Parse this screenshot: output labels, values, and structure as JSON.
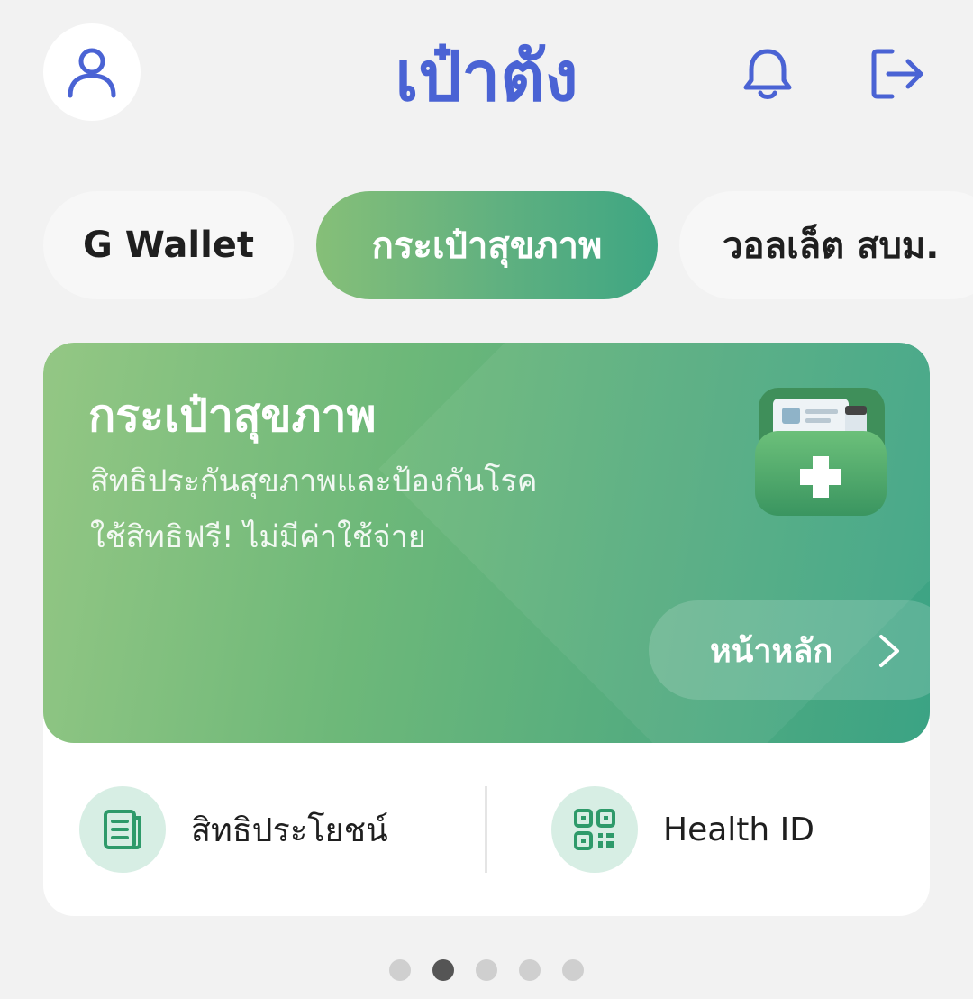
{
  "header": {
    "title": "เป๋าตัง",
    "profile_icon": "user-icon",
    "notification_icon": "bell-icon",
    "logout_icon": "logout-icon"
  },
  "tabs": [
    {
      "label": "G Wallet",
      "active": false
    },
    {
      "label": "กระเป๋าสุขภาพ",
      "active": true
    },
    {
      "label": "วอลเล็ต สบม.",
      "active": false
    }
  ],
  "card": {
    "title": "กระเป๋าสุขภาพ",
    "line1": "สิทธิประกันสุขภาพและป้องกันโรค",
    "line2": "ใช้สิทธิฟรี! ไม่มีค่าใช้จ่าย",
    "icon": "health-wallet-icon",
    "home_button": "หน้าหลัก",
    "actions": [
      {
        "label": "สิทธิประโยชน์",
        "icon": "document-icon"
      },
      {
        "label": "Health ID",
        "icon": "qr-code-icon"
      }
    ]
  },
  "pager": {
    "count": 5,
    "active_index": 1
  },
  "colors": {
    "brand": "#4a63d4",
    "green_start": "#94c784",
    "green_end": "#3ba384",
    "action_bg": "#d7eee4"
  }
}
